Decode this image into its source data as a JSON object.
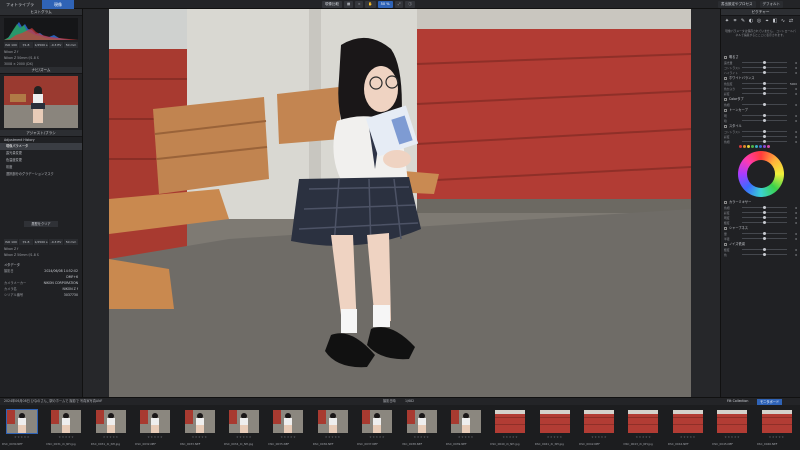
{
  "topbar": {
    "tab_browse": "フォトライブラリ",
    "tab_edit": "現像",
    "center_buttons": [
      "現像比較",
      "",
      "",
      "",
      "50 %",
      "",
      ""
    ],
    "right_buttons": [
      "書出設定やプロセス",
      "デフォルト"
    ]
  },
  "left": {
    "histogram_title": "ヒストグラム",
    "exif1": [
      "ISO 100",
      "f/1.8",
      "1/2500 s",
      "-0.3 EV",
      "50 mm"
    ],
    "camera_row": "Nikon Z f",
    "lens_row": "Nikon Z 50mm f/1.8 S",
    "info_rows": [
      "3008 × 2000 (DX)",
      ""
    ],
    "navigator_title": "ナビ/ズーム",
    "adjust_title": "アジャスト/ブラシ",
    "history_title": "Adjustment History",
    "history_items": [
      "現像パラメータ",
      "露光量変更",
      "色温度変更",
      "彩度",
      "選択部分のグラデーションマスク"
    ],
    "reset_button": "履歴をクリア",
    "exif2": [
      "ISO 100",
      "f/1.8",
      "1/2500 s",
      "-0.3 EV",
      "50 mm"
    ],
    "meta_title": "メタデータ",
    "meta_rows": [
      [
        "撮影日",
        "2024/06/08 14:52:02"
      ],
      [
        "",
        "DMF+6"
      ],
      [
        "カメラメーカー",
        "NIKON CORPORATION"
      ],
      [
        "カメラ名",
        "NIKON Z f"
      ],
      [
        "シリアル番号",
        "3037730"
      ]
    ]
  },
  "right": {
    "top_label": "ピクチャー",
    "message": "現像パラメータは保存されていません。\nコントロールパネルで編集するとここに表示されます。",
    "sections": [
      {
        "label": "明るさ",
        "sliders": [
          [
            "露光量",
            "0"
          ],
          [
            "コントラスト",
            "0"
          ],
          [
            "ハイライト",
            "0"
          ]
        ]
      },
      {
        "label": "ホワイトバランス",
        "sliders": [
          [
            "色温度",
            "5000"
          ],
          [
            "色かぶり",
            "0"
          ],
          [
            "彩度",
            "0"
          ]
        ]
      },
      {
        "label": "Colorタブ",
        "sliders": [
          [
            "色相",
            "0"
          ]
        ]
      },
      {
        "label": "トーンカーブ",
        "sliders": [
          [
            "明",
            "0"
          ],
          [
            "暗",
            "0"
          ]
        ]
      },
      {
        "label": "スタイル",
        "sliders": [
          [
            "コントラスト",
            "0"
          ],
          [
            "彩度",
            "0"
          ],
          [
            "色相",
            "0"
          ]
        ]
      },
      {
        "label": "カラーミキサー",
        "sliders": [
          [
            "色相",
            "0"
          ],
          [
            "彩度",
            "0"
          ],
          [
            "明度",
            "0"
          ],
          [
            "輝度",
            "0"
          ]
        ]
      },
      {
        "label": "シャープネス",
        "sliders": [
          [
            "量",
            "0"
          ],
          [
            "半径",
            "0"
          ]
        ]
      },
      {
        "label": "ノイズ低減",
        "sliders": [
          [
            "輝度",
            "0"
          ],
          [
            "色",
            "0"
          ]
        ]
      }
    ],
    "colors": [
      "#d23a3a",
      "#e08a2a",
      "#e8d23a",
      "#4fb04a",
      "#3ab0c0",
      "#3a6ad2",
      "#8a4ad2",
      "#d24aa8"
    ]
  },
  "filmbar": {
    "path": "2024年06月08日 ひなのさん_ 駅のホームで 撮影で 写真家写真ANF",
    "sort": "撮影日時",
    "count": "1/682",
    "filter": "Filt Collection",
    "monitor": "モニタボード"
  },
  "film": [
    {
      "name": "DSC_0030.NEF",
      "type": "girl"
    },
    {
      "name": "DSC_0031_Xi_NH.jpg",
      "type": "girl"
    },
    {
      "name": "DSC_0031_Xi_NH.jpg",
      "type": "girl"
    },
    {
      "name": "DSC_0032.NEF",
      "type": "girl"
    },
    {
      "name": "DSC_0033.NEF",
      "type": "girl"
    },
    {
      "name": "DSC_0034_Xi_NH.jpg",
      "type": "girl"
    },
    {
      "name": "DSC_0035.NEF",
      "type": "girl"
    },
    {
      "name": "DSC_0036.NEF",
      "type": "girl"
    },
    {
      "name": "DSC_0037.NEF",
      "type": "girl"
    },
    {
      "name": "DSC_0038.NEF",
      "type": "girl"
    },
    {
      "name": "DSC_0039.NEF",
      "type": "girl"
    },
    {
      "name": "DSC_0040_Xi_NH.jpg",
      "type": "wall"
    },
    {
      "name": "DSC_0041_Xi_NH.jpg",
      "type": "wall"
    },
    {
      "name": "DSC_0042.NEF",
      "type": "wall"
    },
    {
      "name": "DSC_0043_Xi_NH.jpg",
      "type": "wall"
    },
    {
      "name": "DSC_0044.NEF",
      "type": "wall"
    },
    {
      "name": "DSC_0045.NEF",
      "type": "wall"
    },
    {
      "name": "DSC_0046.NEF",
      "type": "wall"
    }
  ]
}
